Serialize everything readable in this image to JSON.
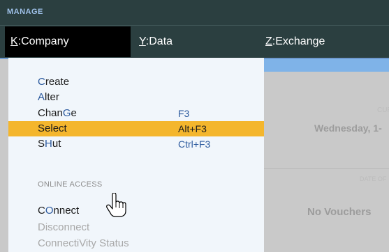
{
  "header": {
    "section_label": "MANAGE",
    "tabs": [
      {
        "key": "K",
        "sep": ":",
        "label": "Company"
      },
      {
        "key": "Y",
        "sep": ":",
        "label": "Data"
      },
      {
        "key": "Z",
        "sep": ":",
        "label": "Exchange"
      }
    ]
  },
  "menu": {
    "items": [
      {
        "hk": "C",
        "rest": "reate",
        "shortcut": ""
      },
      {
        "hk": "A",
        "rest": "lter",
        "shortcut": ""
      },
      {
        "pre": "Chan",
        "hk": "G",
        "rest": "e",
        "shortcut": "F3"
      },
      {
        "hk": "S",
        "rest": "elect",
        "shortcut": "Alt+F3"
      },
      {
        "pre": "S",
        "hk": "H",
        "rest": "ut",
        "shortcut": "Ctrl+F3"
      }
    ],
    "section_heading": "ONLINE ACCESS",
    "online_items": [
      {
        "pre": "C",
        "hk": "O",
        "rest": "nnect"
      },
      {
        "text": "Disconnect"
      },
      {
        "text": "ConnectiVity Status"
      }
    ]
  },
  "background": {
    "current_label": "CURR",
    "current_date": "Wednesday, 1-",
    "date_of_label": "DATE OF",
    "no_vouchers": "No Vouchers"
  }
}
